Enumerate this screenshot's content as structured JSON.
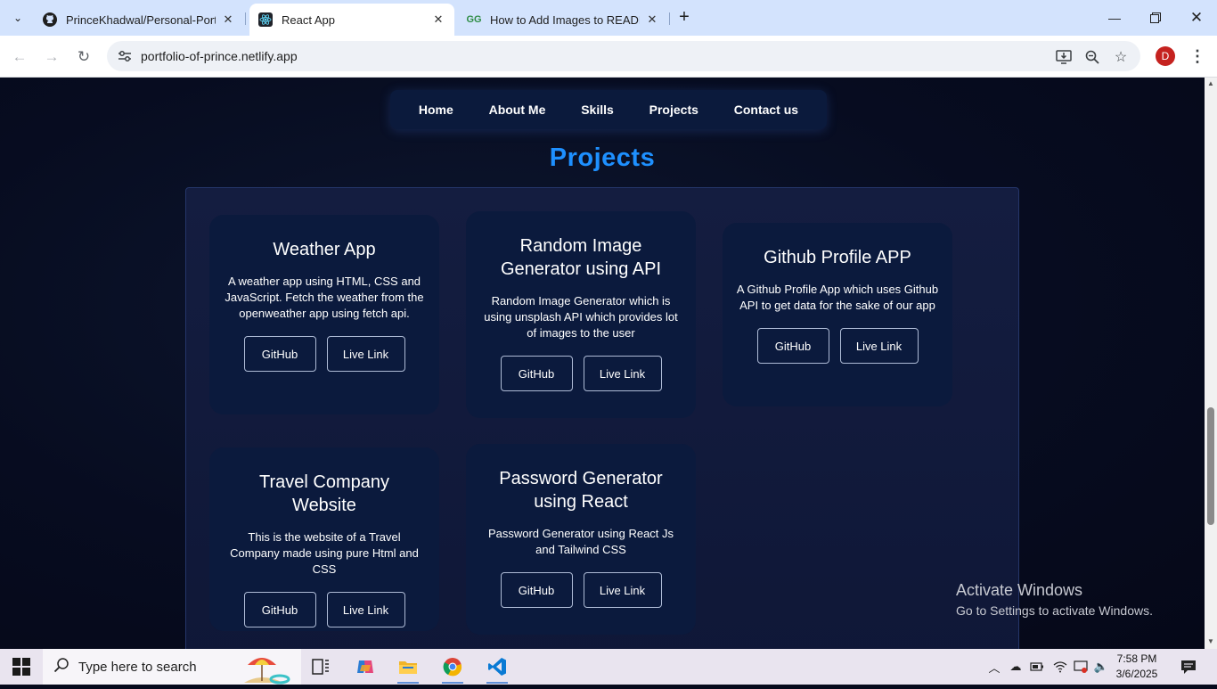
{
  "browser": {
    "tabs": [
      {
        "title": "PrinceKhadwal/Personal-Portfolio",
        "icon": "github-icon"
      },
      {
        "title": "React App",
        "icon": "react-icon"
      },
      {
        "title": "How to Add Images to README",
        "icon": "geeksforgeeks-icon"
      }
    ],
    "url": "portfolio-of-prince.netlify.app",
    "profile_initial": "D"
  },
  "page": {
    "nav": [
      "Home",
      "About Me",
      "Skills",
      "Projects",
      "Contact us"
    ],
    "section_title": "Projects",
    "projects": [
      {
        "title": "Weather App",
        "description": "A weather app using HTML, CSS and JavaScript. Fetch the weather from the openweather app using fetch api.",
        "github_label": "GitHub",
        "live_label": "Live Link"
      },
      {
        "title": "Random Image Generator using API",
        "description": "Random Image Generator which is using unsplash API which provides lot of images to the user",
        "github_label": "GitHub",
        "live_label": "Live Link"
      },
      {
        "title": "Github Profile APP",
        "description": "A Github Profile App which uses Github API to get data for the sake of our app",
        "github_label": "GitHub",
        "live_label": "Live Link"
      },
      {
        "title": "Travel Company Website",
        "description": "This is the website of a Travel Company made using pure Html and CSS",
        "github_label": "GitHub",
        "live_label": "Live Link"
      },
      {
        "title": "Password Generator using React",
        "description": "Password Generator using React Js and Tailwind CSS",
        "github_label": "GitHub",
        "live_label": "Live Link"
      }
    ]
  },
  "watermark": {
    "line1": "Activate Windows",
    "line2": "Go to Settings to activate Windows."
  },
  "taskbar": {
    "search_placeholder": "Type here to search",
    "time": "7:58 PM",
    "date": "3/6/2025"
  }
}
